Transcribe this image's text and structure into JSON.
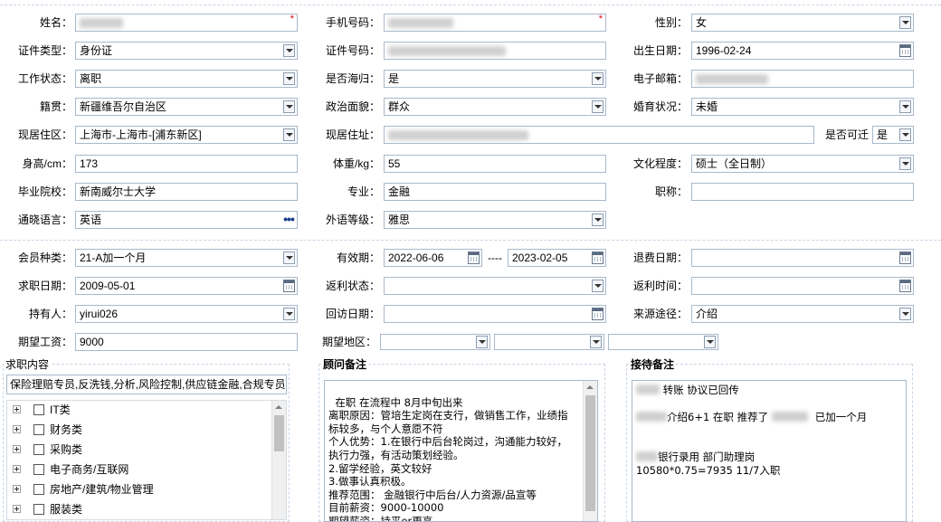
{
  "form": {
    "name": {
      "label": "姓名：",
      "value": ""
    },
    "phone": {
      "label": "手机号码：",
      "value": ""
    },
    "gender": {
      "label": "性别：",
      "value": "女"
    },
    "id_type": {
      "label": "证件类型：",
      "value": "身份证"
    },
    "id_number": {
      "label": "证件号码：",
      "value": ""
    },
    "birth_date": {
      "label": "出生日期：",
      "value": "1996-02-24"
    },
    "work_status": {
      "label": "工作状态：",
      "value": "离职"
    },
    "overseas": {
      "label": "是否海归：",
      "value": "是"
    },
    "email": {
      "label": "电子邮箱：",
      "value": ""
    },
    "native_place": {
      "label": "籍贯：",
      "value": "新疆维吾尔自治区"
    },
    "political": {
      "label": "政治面貌：",
      "value": "群众"
    },
    "marital": {
      "label": "婚育状况：",
      "value": "未婚"
    },
    "current_area": {
      "label": "现居住区：",
      "value": "上海市-上海市-[浦东新区]"
    },
    "current_address": {
      "label": "现居住址：",
      "value": ""
    },
    "relocate": {
      "label": "是否可迁",
      "value": "是"
    },
    "height": {
      "label": "身高/cm：",
      "value": "173"
    },
    "weight": {
      "label": "体重/kg：",
      "value": "55"
    },
    "education": {
      "label": "文化程度：",
      "value": "硕士（全日制）"
    },
    "school": {
      "label": "毕业院校：",
      "value": "新南威尔士大学"
    },
    "major": {
      "label": "专业：",
      "value": "金融"
    },
    "title": {
      "label": "职称：",
      "value": ""
    },
    "language": {
      "label": "通晓语言：",
      "value": "英语"
    },
    "lang_level": {
      "label": "外语等级：",
      "value": "雅思"
    },
    "member_type": {
      "label": "会员种类：",
      "value": "21-A加一个月"
    },
    "validity": {
      "label": "有效期：",
      "from": "2022-06-06",
      "sep": "----",
      "to": "2023-02-05"
    },
    "refund_date": {
      "label": "退费日期：",
      "value": ""
    },
    "job_date": {
      "label": "求职日期：",
      "value": "2009-05-01"
    },
    "rebate_status": {
      "label": "返利状态：",
      "value": ""
    },
    "rebate_time": {
      "label": "返利时间：",
      "value": ""
    },
    "holder": {
      "label": "持有人：",
      "value": "yirui026"
    },
    "visit_date": {
      "label": "回访日期：",
      "value": ""
    },
    "source": {
      "label": "来源途径：",
      "value": "介绍"
    },
    "salary": {
      "label": "期望工资：",
      "value": "9000"
    },
    "region": {
      "label": "期望地区：",
      "values": [
        "",
        "",
        ""
      ]
    }
  },
  "job_panel": {
    "title": "求职内容",
    "summary": "保险理赔专员,反洗钱,分析,风险控制,供应链金融,合规专员",
    "tree": [
      "IT类",
      "财务类",
      "采购类",
      "电子商务/互联网",
      "房地产/建筑/物业管理",
      "服装类"
    ]
  },
  "advisor_panel": {
    "title": "顾问备注",
    "text": "在职 在流程中 8月中旬出来\n离职原因：管培生定岗在支行，做销售工作，业绩指\n标较多，与个人意愿不符\n个人优势：1.在银行中后台轮岗过，沟通能力较好，\n执行力强，有活动策划经验。\n2.留学经验，英文较好\n3.做事认真积极。\n推荐范围： 金融银行中后台/人力资源/品宣等\n目前薪资：9000-10000\n期望薪资：持平or更高"
  },
  "reception_panel": {
    "title": "接待备注",
    "line1": "转账 协议已回传",
    "line2a": "介绍6+1   在职   推荐了",
    "line2b": "已加一个月",
    "line3": "银行录用 部门助理岗",
    "line4": "10580*0.75=7935  11/7入职"
  },
  "colors": {
    "border": "#a9b9cc",
    "required": "#dd0000",
    "dash": "#c7d6e6"
  }
}
